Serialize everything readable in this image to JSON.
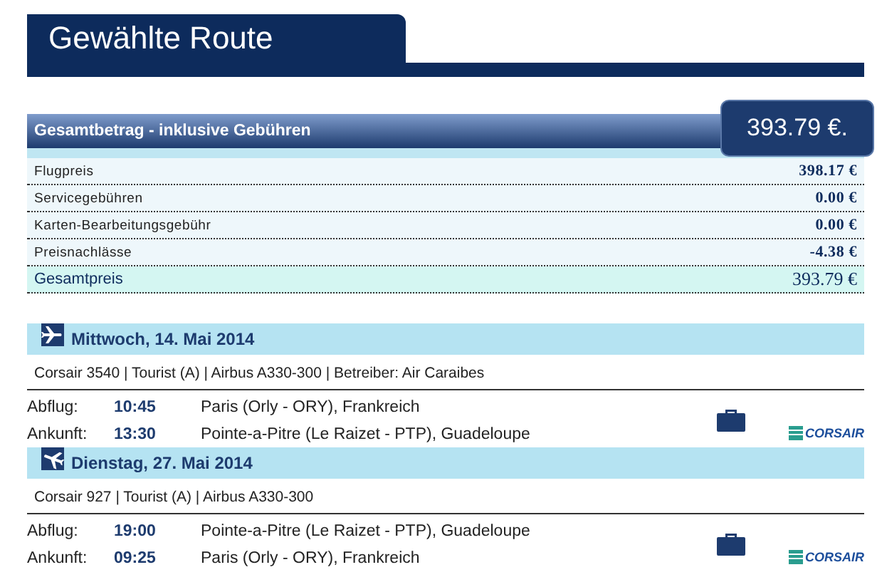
{
  "title": "Gewählte Route",
  "summary": {
    "heading": "Gesamtbetrag - inklusive Gebühren",
    "total_badge": "393.79 €.",
    "rows": [
      {
        "label": "Flugpreis",
        "amount": "398.17 €",
        "kind": "item"
      },
      {
        "label": "Servicegebühren",
        "amount": "0.00 €",
        "kind": "item"
      },
      {
        "label": "Karten-Bearbeitungsgebühr",
        "amount": "0.00 €",
        "kind": "item"
      },
      {
        "label": "Preisnachlässe",
        "amount": "-4.38 €",
        "kind": "item"
      },
      {
        "label": "Gesamtpreis",
        "amount": "393.79 €",
        "kind": "total"
      }
    ]
  },
  "flights": [
    {
      "kind": "outbound",
      "date": "Mittwoch, 14. Mai 2014",
      "info": "Corsair 3540 | Tourist (A) | Airbus A330-300 | Betreiber: Air Caraibes",
      "airline_logo": "CORSAIR",
      "legs": [
        {
          "label": "Abflug:",
          "time": "10:45",
          "place": "Paris (Orly - ORY), Frankreich"
        },
        {
          "label": "Ankunft:",
          "time": "13:30",
          "place": "Pointe-a-Pitre (Le Raizet - PTP), Guadeloupe"
        }
      ]
    },
    {
      "kind": "return",
      "date": "Dienstag, 27. Mai 2014",
      "info": "Corsair 927 | Tourist (A) | Airbus A330-300",
      "airline_logo": "CORSAIR",
      "legs": [
        {
          "label": "Abflug:",
          "time": "19:00",
          "place": "Pointe-a-Pitre (Le Raizet - PTP), Guadeloupe"
        },
        {
          "label": "Ankunft:",
          "time": "09:25",
          "place": "Paris (Orly - ORY), Frankreich"
        }
      ]
    }
  ]
}
